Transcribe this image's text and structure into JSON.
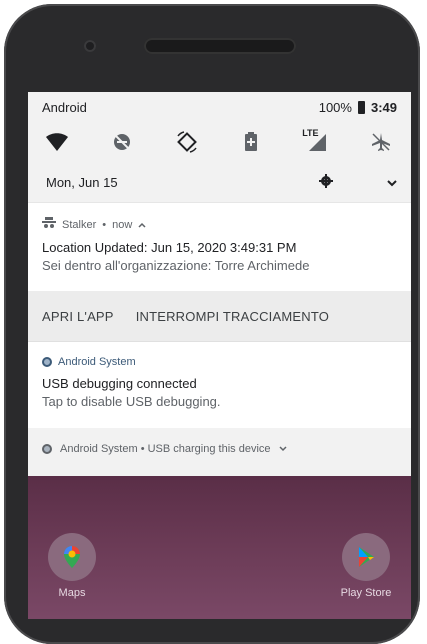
{
  "status_bar": {
    "carrier": "Android",
    "battery": "100%",
    "time": "3:49"
  },
  "quick_settings": {
    "tiles": [
      {
        "icon": "wifi-icon"
      },
      {
        "icon": "do-not-disturb-off-icon"
      },
      {
        "icon": "auto-rotate-icon"
      },
      {
        "icon": "battery-saver-icon"
      },
      {
        "icon": "mobile-data-lte-icon",
        "badge": "LTE"
      },
      {
        "icon": "airplane-mode-icon"
      }
    ],
    "date": "Mon, Jun 15",
    "settings_icon": "gear-icon",
    "expand_icon": "chevron-down-icon"
  },
  "notifications": {
    "stalker": {
      "app": "Stalker",
      "time": "now",
      "title": "Location Updated: Jun 15, 2020 3:49:31 PM",
      "text": "Sei dentro all'organizzazione: Torre Archimede",
      "actions": [
        "APRI L'APP",
        "INTERROMPI TRACCIAMENTO"
      ]
    },
    "usb_debug": {
      "app": "Android System",
      "title": "USB debugging connected",
      "text": "Tap to disable USB debugging."
    },
    "usb_charging": {
      "text": "Android System • USB charging this device"
    }
  },
  "home_screen": {
    "apps": [
      {
        "label": "Maps",
        "icon": "maps-icon"
      },
      {
        "label": "Play Store",
        "icon": "play-store-icon"
      }
    ]
  },
  "colors": {
    "panel_bg": "#f2f2f2",
    "card_bg": "#ffffff",
    "wallpaper": "#6a3a55",
    "phone_frame": "#2a2a2c"
  }
}
